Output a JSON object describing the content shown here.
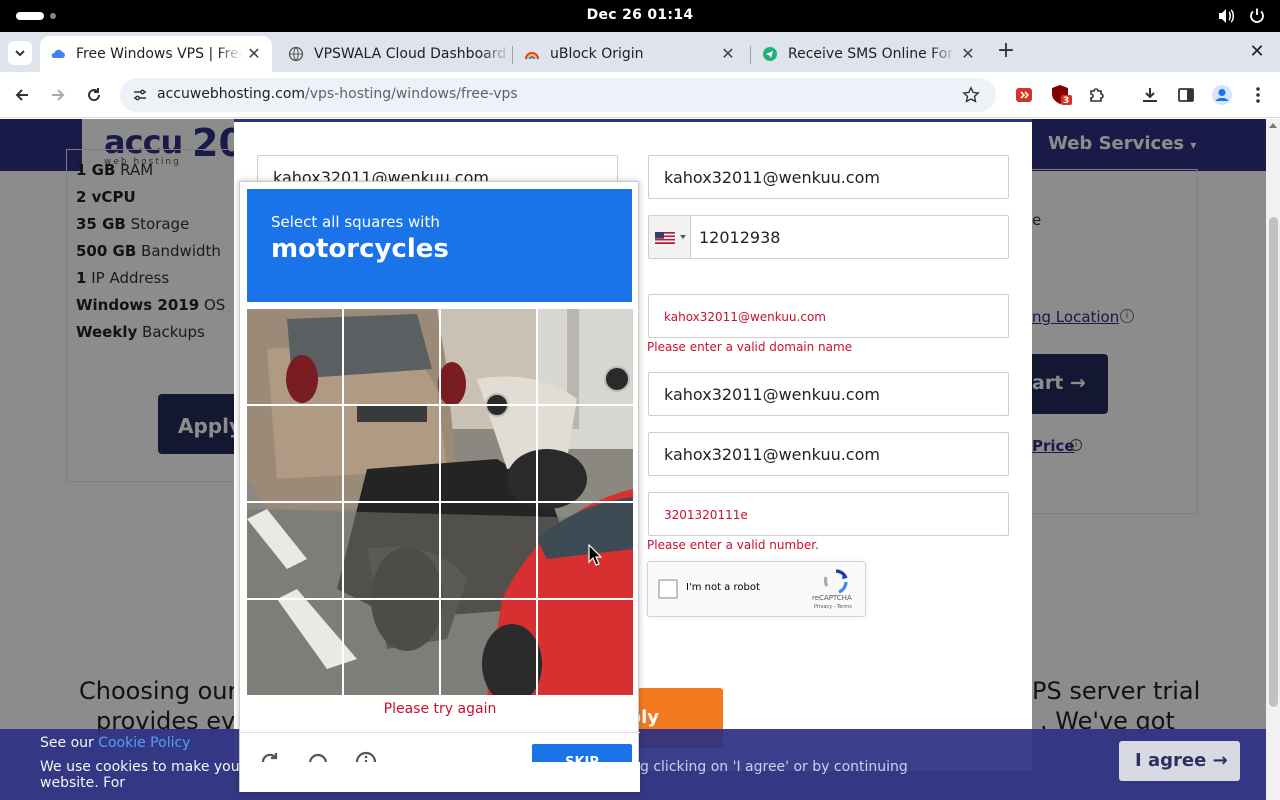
{
  "os": {
    "clock": "Dec 26  01:14",
    "volume_icon": "volume-icon",
    "power_icon": "power-icon"
  },
  "tabs": [
    {
      "title": "Free Windows VPS | Free Windows VPS Trial",
      "active": true,
      "icon": "cloud-favicon"
    },
    {
      "title": "VPSWALA Cloud Dashboard",
      "active": false,
      "icon": "globe-favicon"
    },
    {
      "title": "uBlock Origin",
      "active": false,
      "icon": "rainbow-favicon"
    },
    {
      "title": "Receive SMS Online For Free",
      "active": false,
      "icon": "sms-favicon"
    }
  ],
  "toolbar": {
    "url_host": "accuwebhosting.com",
    "url_path": "/vps-hosting/windows/free-vps",
    "extension_badge": "3"
  },
  "site": {
    "logo_text": "accu",
    "logo_anniv": "20",
    "logo_sub": "web hosting",
    "nav_web_services": "Web Services"
  },
  "features": [
    {
      "bold": "1 GB",
      "text": " RAM"
    },
    {
      "bold": "2 vCPU",
      "text": ""
    },
    {
      "bold": "35 GB",
      "text": " Storage"
    },
    {
      "bold": "500 GB",
      "text": " Bandwidth"
    },
    {
      "bold": "1",
      "text": " IP Address"
    },
    {
      "bold": "Windows 2019",
      "text": " OS"
    },
    {
      "bold": "Weekly",
      "text": " Backups"
    }
  ],
  "left_apply": "Apply",
  "right_side": {
    "letter": "e",
    "location_link": "ng Location",
    "cart_label": "art",
    "price_link": "Price"
  },
  "body_text": {
    "line1_left": "Choosing our",
    "line2_left": "provides ev",
    "line1_right": "PS server trial",
    "line2_right": ". We've got"
  },
  "form": {
    "field_top_left": "kahox32011@wenkuu.com",
    "email": "kahox32011@wenkuu.com",
    "phone_number": "12012938",
    "domain_value": "kahox32011@wenkuu.com",
    "domain_error": "Please enter a valid domain name",
    "field_4": "kahox32011@wenkuu.com",
    "field_5": "kahox32011@wenkuu.com",
    "number_value": "3201320111e",
    "number_error": "Please enter a valid number.",
    "robot_label": "I'm not a robot",
    "recaptcha_name": "reCAPTCHA",
    "recaptcha_terms": "Privacy - Terms",
    "apply_label": "ply"
  },
  "cookie": {
    "see_our": "See our ",
    "policy_link": "Cookie Policy",
    "text": "We use cookies to make your experience better. By continuing your use of this website. For",
    "text_hidden_tail": "g clicking on 'I agree' or by continuing",
    "agree_label": "I agree"
  },
  "recaptcha": {
    "select_all": "Select all squares with",
    "object": "motorcycles",
    "try_again": "Please try again",
    "skip_label": "SKIP",
    "tiles_selected": 0,
    "grid_size": "4x4"
  },
  "colors": {
    "brand_navy": "#2e3183",
    "recaptcha_blue": "#1a73e8",
    "error_red": "#c8102e",
    "apply_orange": "#f47a20"
  }
}
